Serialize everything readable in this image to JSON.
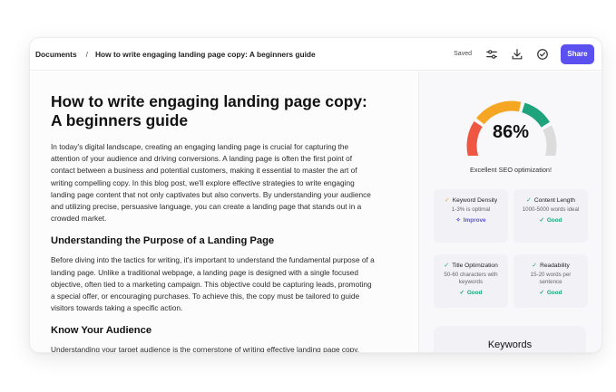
{
  "breadcrumb": {
    "root": "Documents",
    "separator": "/",
    "current": "How to write engaging landing page copy: A beginners guide"
  },
  "toolbar": {
    "saved_label": "Saved",
    "settings_icon": "sliders-icon",
    "download_icon": "download-icon",
    "check_icon": "check-circle-icon",
    "share_label": "Share",
    "share_color": "#5b50f0"
  },
  "document": {
    "title": "How to write engaging landing page copy: A beginners guide",
    "intro": "In today's digital landscape, creating an engaging landing page is crucial for capturing the attention of your audience and driving conversions. A landing page is often the first point of contact between a business and potential customers, making it essential to master the art of writing compelling copy. In this blog post, we'll explore effective strategies to write engaging landing page content that not only captivates but also converts. By understanding your audience and utilizing precise, persuasive language, you can create a landing page that stands out in a crowded market.",
    "section1_heading": "Understanding the Purpose of a Landing Page",
    "section1_text": "Before diving into the tactics for writing, it's important to understand the fundamental purpose of a landing page. Unlike a traditional webpage, a landing page is designed with a single focused objective, often tied to a marketing campaign. This objective could be capturing leads, promoting a special offer, or encouraging purchases. To achieve this, the copy must be tailored to guide visitors towards taking a specific action.",
    "section2_heading": "Know Your Audience",
    "section2_text": "Understanding your target audience is the cornerstone of writing effective landing page copy. Knowing who will land on your page enables you to tailor content that resonates with"
  },
  "seo": {
    "score_value": 86,
    "score_text": "86%",
    "score_label": "Excellent SEO optimization!",
    "gauge_colors": [
      "#ef5742",
      "#f5a623",
      "#1ea37c",
      "#dcdcdc"
    ],
    "cards": [
      {
        "title": "Keyword Density",
        "desc": "1-3% is optimal",
        "status": "Improve",
        "status_icon": "sparkle-icon",
        "status_color": "#5b50f0",
        "head_icon": "check-icon",
        "head_color": "#f5a623"
      },
      {
        "title": "Content Length",
        "desc": "1000-5000 words ideal",
        "status": "Good",
        "status_icon": "check-icon",
        "status_color": "#1ea37c",
        "head_icon": "check-icon",
        "head_color": "#1ea37c"
      },
      {
        "title": "Title Optimization",
        "desc": "50-60 characters with keywords",
        "status": "Good",
        "status_icon": "check-icon",
        "status_color": "#1ea37c",
        "head_icon": "check-icon",
        "head_color": "#1ea37c"
      },
      {
        "title": "Readability",
        "desc": "15-20 words per sentence",
        "status": "Good",
        "status_icon": "check-icon",
        "status_color": "#1ea37c",
        "head_icon": "check-icon",
        "head_color": "#1ea37c"
      }
    ],
    "keywords_title": "Keywords"
  }
}
